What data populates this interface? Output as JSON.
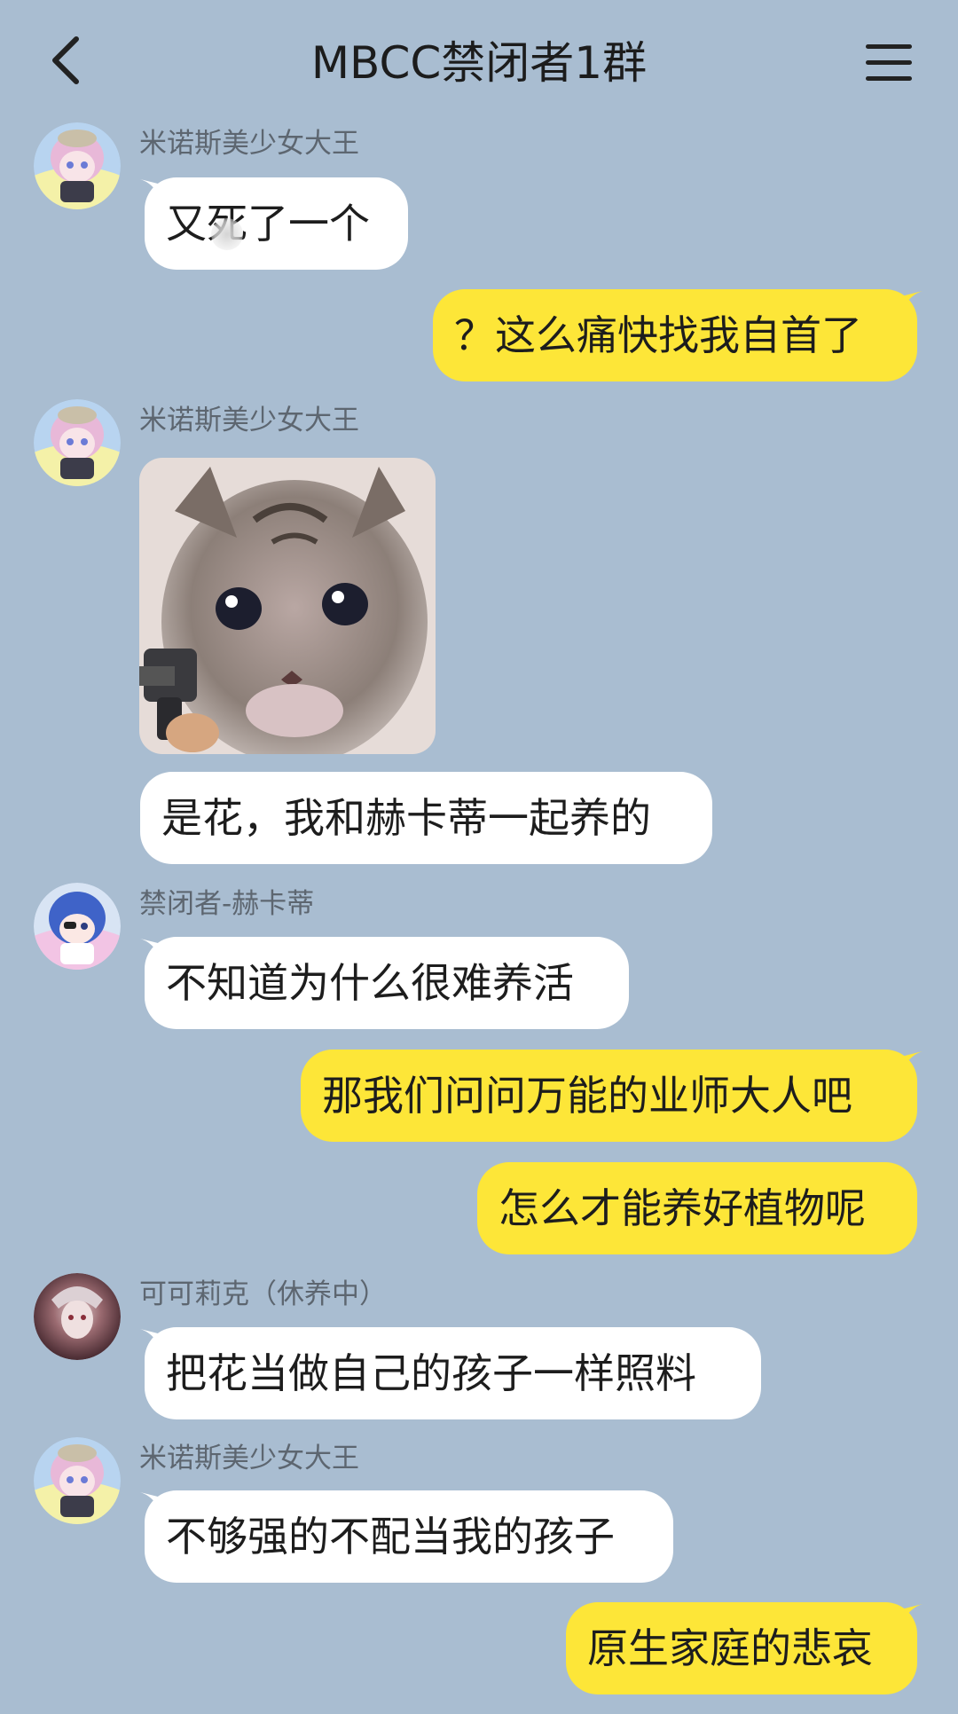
{
  "header": {
    "title": "MBCC禁闭者1群",
    "back_icon": "chevron-left-icon",
    "menu_icon": "hamburger-menu-icon"
  },
  "colors": {
    "background": "#a9bdd1",
    "incoming_bubble": "#ffffff",
    "outgoing_bubble": "#fde638"
  },
  "messages": [
    {
      "direction": "in",
      "sender": "米诺斯美少女大王",
      "text": "又死了一个"
    },
    {
      "direction": "out",
      "text": "？这么痛快找我自首了"
    },
    {
      "direction": "in",
      "sender": "米诺斯美少女大王",
      "image": "kitten-with-pistol-sticker"
    },
    {
      "direction": "in",
      "text": "是花，我和赫卡蒂一起养的"
    },
    {
      "direction": "in",
      "sender": "禁闭者-赫卡蒂",
      "text": "不知道为什么很难养活"
    },
    {
      "direction": "out",
      "text": "那我们问问万能的业师大人吧"
    },
    {
      "direction": "out",
      "text": "怎么才能养好植物呢"
    },
    {
      "direction": "in",
      "sender": "可可莉克（休养中）",
      "text": "把花当做自己的孩子一样照料"
    },
    {
      "direction": "in",
      "sender": "米诺斯美少女大王",
      "text": "不够强的不配当我的孩子"
    },
    {
      "direction": "out",
      "text": "原生家庭的悲哀"
    }
  ]
}
